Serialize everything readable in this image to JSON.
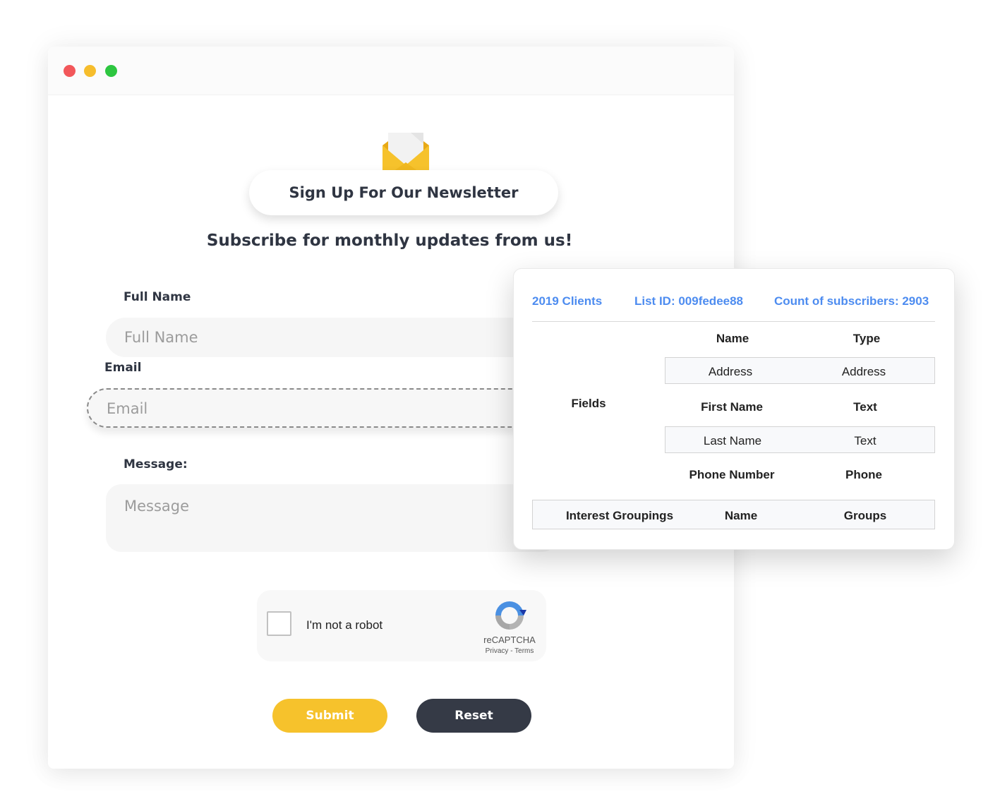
{
  "window": {
    "controls": [
      "close",
      "minimize",
      "maximize"
    ],
    "colors": {
      "close": "#f2575a",
      "minimize": "#f6bd2c",
      "maximize": "#2dc640"
    }
  },
  "form": {
    "title": "Sign Up For Our Newsletter",
    "subtitle": "Subscribe for monthly updates from us!",
    "fields": {
      "full_name": {
        "label": "Full Name",
        "placeholder": "Full Name"
      },
      "email": {
        "label": "Email",
        "placeholder": "Email"
      },
      "message": {
        "label": "Message:",
        "placeholder": "Message"
      }
    },
    "captcha": {
      "label": "I'm not a robot",
      "brand": "reCAPTCHA",
      "links": "Privacy - Terms",
      "checked": false
    },
    "buttons": {
      "submit": "Submit",
      "reset": "Reset"
    },
    "accent": "#f6c22c",
    "dark": "#353a46"
  },
  "list_card": {
    "list_name": "2019 Clients",
    "list_id": "List ID: 009fedee88",
    "subscriber_count": "Count of subscribers: 2903",
    "accent": "#4d8cf0",
    "fields_label": "Fields",
    "headers": {
      "name": "Name",
      "type": "Type"
    },
    "fields": [
      {
        "name": "Address",
        "type": "Address"
      },
      {
        "name": "First Name",
        "type": "Text"
      },
      {
        "name": "Last Name",
        "type": "Text"
      },
      {
        "name": "Phone Number",
        "type": "Phone"
      }
    ],
    "interest_groupings": {
      "label": "Interest Groupings",
      "name": "Name",
      "groups": "Groups"
    }
  }
}
